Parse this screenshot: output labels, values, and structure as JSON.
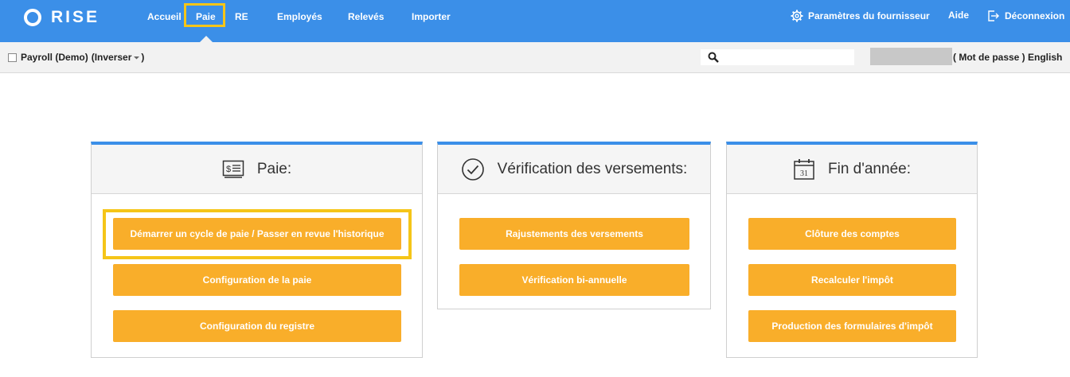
{
  "brand": {
    "name": "RISE"
  },
  "nav": {
    "items": [
      {
        "label": "Accueil"
      },
      {
        "label": "Paie"
      },
      {
        "label": "RE"
      },
      {
        "label": "Employés"
      },
      {
        "label": "Relevés"
      },
      {
        "label": "Importer"
      }
    ],
    "active": "Paie",
    "right": {
      "settings": "Paramètres du fournisseur",
      "help": "Aide",
      "logout": "Déconnexion"
    }
  },
  "subbar": {
    "company": "Payroll (Demo)",
    "invert_open": "(",
    "invert_label": "Inverser",
    "invert_close": ")",
    "search_placeholder": "",
    "user_links": "( Mot de passe ) English"
  },
  "cards": [
    {
      "title": "Paie:",
      "icon": "pay-stub-icon",
      "buttons": [
        "Démarrer un cycle de paie / Passer en revue l'historique",
        "Configuration de la paie",
        "Configuration du registre"
      ]
    },
    {
      "title": "Vérification des versements:",
      "icon": "check-circle-icon",
      "buttons": [
        "Rajustements des versements",
        "Vérification bi-annuelle"
      ]
    },
    {
      "title": "Fin d'année:",
      "icon": "calendar-icon",
      "calendar_day": "31",
      "buttons": [
        "Clôture des comptes",
        "Recalculer l'impôt",
        "Production des formulaires d'impôt"
      ]
    }
  ],
  "colors": {
    "nav_bg": "#3b8fe8",
    "button": "#f9ae2a",
    "highlight": "#f5c518"
  }
}
